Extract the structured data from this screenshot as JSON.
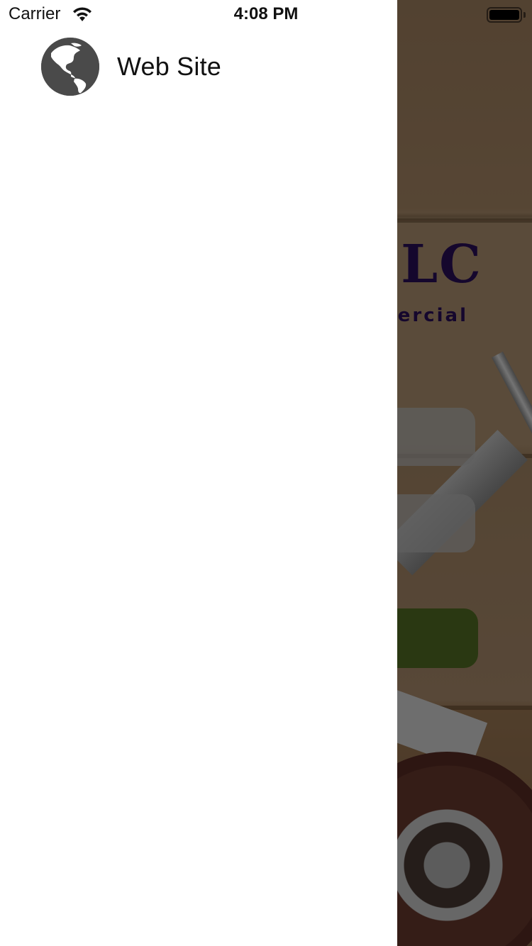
{
  "status_bar": {
    "carrier": "Carrier",
    "time": "4:08 PM"
  },
  "drawer": {
    "items": [
      {
        "label": "Web Site",
        "icon": "globe-icon"
      }
    ]
  },
  "background_app": {
    "logo_text": "LC",
    "logo_subtitle": "ercial",
    "logo_dots": "..",
    "colors": {
      "logo": "#2a0f5a",
      "button": "#557024",
      "field": "#bebebe"
    }
  }
}
